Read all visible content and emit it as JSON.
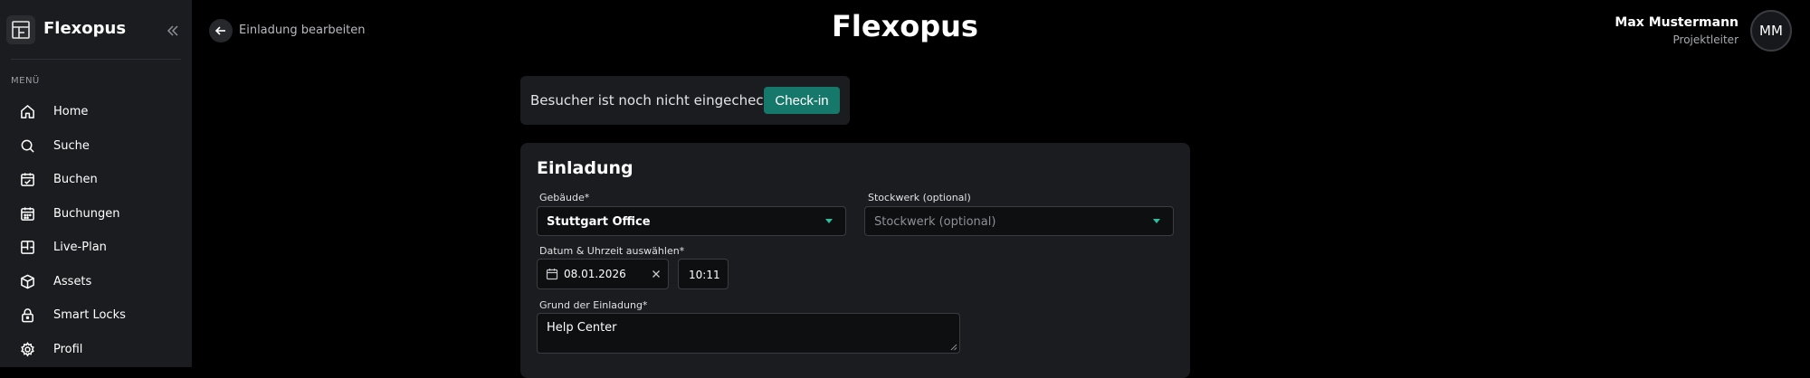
{
  "sidebar": {
    "brand": "Flexopus",
    "menu_heading": "MENÜ",
    "items": [
      {
        "label": "Home",
        "icon": "home-icon"
      },
      {
        "label": "Suche",
        "icon": "search-icon"
      },
      {
        "label": "Buchen",
        "icon": "calendar-check-icon"
      },
      {
        "label": "Buchungen",
        "icon": "calendar-icon"
      },
      {
        "label": "Live-Plan",
        "icon": "floorplan-icon"
      },
      {
        "label": "Assets",
        "icon": "box-icon"
      },
      {
        "label": "Smart Locks",
        "icon": "lock-icon"
      },
      {
        "label": "Profil",
        "icon": "gear-icon"
      }
    ]
  },
  "header": {
    "back_label": "Einladung bearbeiten",
    "app_title": "Flexopus",
    "user_name": "Max Mustermann",
    "user_role": "Projektleiter",
    "avatar_initials": "MM"
  },
  "checkin": {
    "status_text": "Besucher ist noch nicht eingecheckt",
    "button_label": "Check-in",
    "button_color": "#16786b"
  },
  "invitation": {
    "title": "Einladung",
    "building_label": "Gebäude*",
    "building_value": "Stuttgart Office",
    "floor_label": "Stockwerk (optional)",
    "floor_placeholder": "Stockwerk (optional)",
    "datetime_label": "Datum & Uhrzeit auswählen*",
    "date_value": "08.01.2026",
    "time_value": "10:11",
    "reason_label": "Grund der Einladung*",
    "reason_value": "Help Center"
  },
  "colors": {
    "accent": "#2bbf9f",
    "sidebar_bg": "#1b1c1f",
    "page_bg": "#000000"
  }
}
